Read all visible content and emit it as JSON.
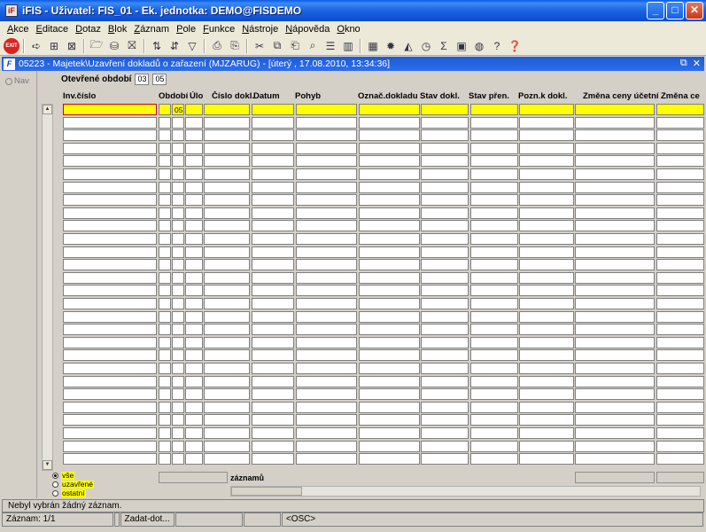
{
  "window": {
    "title": "iFIS - Uživatel: FIS_01 - Ek. jednotka: DEMO@FISDEMO",
    "icon_label": "iF"
  },
  "menu": [
    {
      "u": "A",
      "rest": "kce"
    },
    {
      "u": "E",
      "rest": "ditace"
    },
    {
      "u": "D",
      "rest": "otaz"
    },
    {
      "u": "B",
      "rest": "lok"
    },
    {
      "u": "Z",
      "rest": "áznam"
    },
    {
      "u": "P",
      "rest": "ole"
    },
    {
      "u": "F",
      "rest": "unkce"
    },
    {
      "u": "N",
      "rest": "ástroje"
    },
    {
      "u": "N",
      "rest": "ápověda"
    },
    {
      "u": "O",
      "rest": "kno"
    }
  ],
  "toolbar": {
    "exit_label": "EXIT"
  },
  "form": {
    "title": "05223 - Majetek\\Uzavření dokladů o zařazení (MJZARUG) - [úterý , 17.08.2010, 13:34:36]",
    "icon_label": "F",
    "nav_label": "Nav",
    "period_label": "Otevřené období",
    "period_values": [
      "03",
      "05"
    ],
    "first_row_value": "05",
    "columns": [
      "Inv.číslo",
      "Období",
      "Úlo",
      "Číslo dokl.",
      "Datum",
      "Pohyb",
      "Označ.dokladu",
      "Stav dokl.",
      "Stav přen.",
      "Pozn.k dokl.",
      "Změna ceny účetní",
      "Změna ce"
    ],
    "radios": [
      {
        "label": "vše",
        "selected": true
      },
      {
        "label": "uzavřené",
        "selected": false
      },
      {
        "label": "ostatní",
        "selected": false
      }
    ],
    "records_label": "záznamů"
  },
  "status": {
    "message": "Nebyl vybrán žádný záznam.",
    "record": "Záznam: 1/1",
    "mode": "Zadat-dot...",
    "osc": "<OSC>"
  }
}
